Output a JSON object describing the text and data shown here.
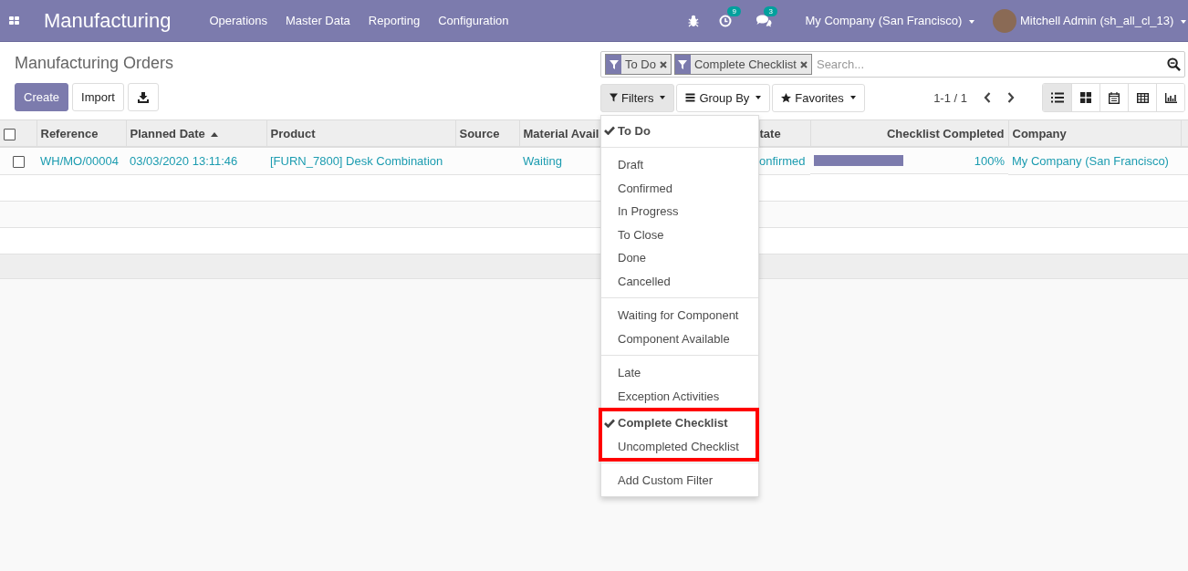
{
  "navbar": {
    "app_title": "Manufacturing",
    "menu": [
      "Operations",
      "Master Data",
      "Reporting",
      "Configuration"
    ],
    "activity_count": "9",
    "message_count": "3",
    "company": "My Company (San Francisco)",
    "user": "Mitchell Admin (sh_all_cl_13)"
  },
  "breadcrumb": "Manufacturing Orders",
  "buttons": {
    "create": "Create",
    "import": "Import"
  },
  "search": {
    "facets": [
      "To Do",
      "Complete Checklist"
    ],
    "placeholder": "Search..."
  },
  "search_options": [
    {
      "label": "Filters",
      "open": true
    },
    {
      "label": "Group By",
      "open": false
    },
    {
      "label": "Favorites",
      "open": false
    }
  ],
  "pager": "1-1 / 1",
  "views": [
    {
      "kind": "list",
      "selected": true
    },
    {
      "kind": "kanban",
      "selected": false
    },
    {
      "kind": "calendar",
      "selected": false
    },
    {
      "kind": "pivot",
      "selected": false
    },
    {
      "kind": "graph",
      "selected": false
    }
  ],
  "table": {
    "select_all_checked": false,
    "columns": [
      "Reference",
      "Planned Date",
      "Product",
      "Source",
      "Material Avail",
      "",
      "tate",
      "Checklist Completed",
      "Company"
    ],
    "rows": [
      {
        "checked": false,
        "reference": "WH/MO/00004",
        "planned_date": "03/03/2020 13:11:46",
        "product": "[FURN_7800] Desk Combination",
        "source": "",
        "material": "Waiting",
        "state": "onfirmed",
        "level": 1,
        "checklist": "100%",
        "company": "My Company (San Francisco)"
      }
    ]
  },
  "filters_menu": [
    {
      "divider_before": false,
      "highlighted": false,
      "items": [
        {
          "label": "To Do",
          "checked": true
        }
      ]
    },
    {
      "divider_before": true,
      "highlighted": false,
      "items": [
        {
          "label": "Draft",
          "checked": false
        },
        {
          "label": "Confirmed",
          "checked": false
        },
        {
          "label": "In Progress",
          "checked": false
        },
        {
          "label": "To Close",
          "checked": false
        },
        {
          "label": "Done",
          "checked": false
        },
        {
          "label": "Cancelled",
          "checked": false
        }
      ]
    },
    {
      "divider_before": true,
      "highlighted": false,
      "items": [
        {
          "label": "Waiting for Component",
          "checked": false
        },
        {
          "label": "Component Available",
          "checked": false
        }
      ]
    },
    {
      "divider_before": true,
      "highlighted": false,
      "items": [
        {
          "label": "Late",
          "checked": false
        },
        {
          "label": "Exception Activities",
          "checked": false
        }
      ]
    },
    {
      "divider_before": false,
      "highlighted": true,
      "items": [
        {
          "label": "Complete Checklist",
          "checked": true
        },
        {
          "label": "Uncompleted Checklist",
          "checked": false
        }
      ]
    },
    {
      "divider_before": true,
      "highlighted": false,
      "items": [
        {
          "label": "Add Custom Filter",
          "checked": false
        }
      ]
    }
  ]
}
